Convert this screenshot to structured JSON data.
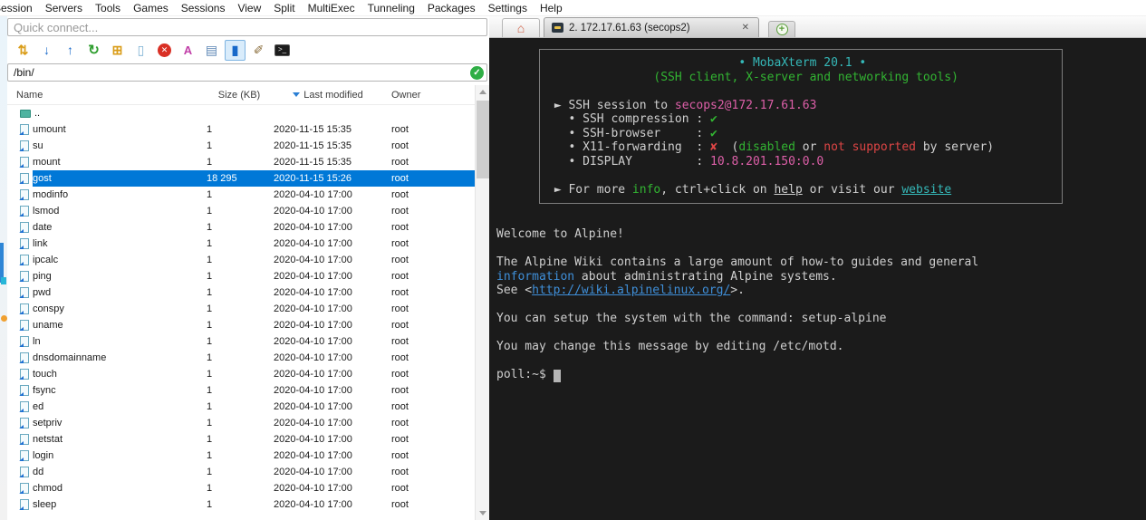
{
  "menu": {
    "items": [
      "Session",
      "Servers",
      "Tools",
      "Games",
      "Sessions",
      "View",
      "Split",
      "MultiExec",
      "Tunneling",
      "Packages",
      "Settings",
      "Help"
    ]
  },
  "sftp": {
    "quick_connect_placeholder": "Quick connect...",
    "path": "/bin/",
    "path_ok_glyph": "✓",
    "columns": {
      "name": "Name",
      "size": "Size (KB)",
      "modified": "Last modified",
      "owner": "Owner"
    },
    "toolbar": [
      {
        "name": "folder-transfer-icon",
        "glyph": "⇅",
        "cls": "tb-yellow"
      },
      {
        "name": "download-icon",
        "glyph": "↓",
        "cls": "tb-blue"
      },
      {
        "name": "upload-icon",
        "glyph": "↑",
        "cls": "tb-blue"
      },
      {
        "name": "refresh-icon",
        "glyph": "↻",
        "cls": "tb-green"
      },
      {
        "name": "new-folder-icon",
        "glyph": "⊞",
        "cls": "tb-yellow"
      },
      {
        "name": "new-file-icon",
        "glyph": "▯",
        "cls": "tb-page"
      },
      {
        "name": "delete-icon",
        "glyph": "✕",
        "cls": "tb-del"
      },
      {
        "name": "rename-icon",
        "glyph": "A",
        "cls": "tb-pink"
      },
      {
        "name": "edit-file-icon",
        "glyph": "▤",
        "cls": "tb-steel"
      },
      {
        "name": "follow-terminal-folder-icon",
        "glyph": "▮",
        "cls": "tb-blue",
        "active": true
      },
      {
        "name": "find-icon",
        "glyph": "✐",
        "cls": "tb-pen"
      },
      {
        "name": "console-icon",
        "glyph": ">_",
        "cls": "tb-console"
      }
    ],
    "rows": [
      {
        "name": "..",
        "size": "",
        "modified": "",
        "owner": "",
        "type": "up"
      },
      {
        "name": "umount",
        "size": "1",
        "modified": "2020-11-15 15:35",
        "owner": "root"
      },
      {
        "name": "su",
        "size": "1",
        "modified": "2020-11-15 15:35",
        "owner": "root"
      },
      {
        "name": "mount",
        "size": "1",
        "modified": "2020-11-15 15:35",
        "owner": "root"
      },
      {
        "name": "gost",
        "size": "18 295",
        "modified": "2020-11-15 15:26",
        "owner": "root",
        "selected": true
      },
      {
        "name": "modinfo",
        "size": "1",
        "modified": "2020-04-10 17:00",
        "owner": "root"
      },
      {
        "name": "lsmod",
        "size": "1",
        "modified": "2020-04-10 17:00",
        "owner": "root"
      },
      {
        "name": "date",
        "size": "1",
        "modified": "2020-04-10 17:00",
        "owner": "root"
      },
      {
        "name": "link",
        "size": "1",
        "modified": "2020-04-10 17:00",
        "owner": "root"
      },
      {
        "name": "ipcalc",
        "size": "1",
        "modified": "2020-04-10 17:00",
        "owner": "root"
      },
      {
        "name": "ping",
        "size": "1",
        "modified": "2020-04-10 17:00",
        "owner": "root"
      },
      {
        "name": "pwd",
        "size": "1",
        "modified": "2020-04-10 17:00",
        "owner": "root"
      },
      {
        "name": "conspy",
        "size": "1",
        "modified": "2020-04-10 17:00",
        "owner": "root"
      },
      {
        "name": "uname",
        "size": "1",
        "modified": "2020-04-10 17:00",
        "owner": "root"
      },
      {
        "name": "ln",
        "size": "1",
        "modified": "2020-04-10 17:00",
        "owner": "root"
      },
      {
        "name": "dnsdomainname",
        "size": "1",
        "modified": "2020-04-10 17:00",
        "owner": "root"
      },
      {
        "name": "touch",
        "size": "1",
        "modified": "2020-04-10 17:00",
        "owner": "root"
      },
      {
        "name": "fsync",
        "size": "1",
        "modified": "2020-04-10 17:00",
        "owner": "root"
      },
      {
        "name": "ed",
        "size": "1",
        "modified": "2020-04-10 17:00",
        "owner": "root"
      },
      {
        "name": "setpriv",
        "size": "1",
        "modified": "2020-04-10 17:00",
        "owner": "root"
      },
      {
        "name": "netstat",
        "size": "1",
        "modified": "2020-04-10 17:00",
        "owner": "root"
      },
      {
        "name": "login",
        "size": "1",
        "modified": "2020-04-10 17:00",
        "owner": "root"
      },
      {
        "name": "dd",
        "size": "1",
        "modified": "2020-04-10 17:00",
        "owner": "root"
      },
      {
        "name": "chmod",
        "size": "1",
        "modified": "2020-04-10 17:00",
        "owner": "root"
      },
      {
        "name": "sleep",
        "size": "1",
        "modified": "2020-04-10 17:00",
        "owner": "root"
      }
    ]
  },
  "tabs": {
    "home_glyph": "⌂",
    "session_tab": "2. 172.17.61.63 (secops2)",
    "close_label": "✕",
    "new_tab_label": "+"
  },
  "colors": {
    "selection_blue": "#0078d7",
    "terminal_bg": "#1b1b1b",
    "terminal_cyan": "#35b8b8",
    "terminal_green": "#32b432",
    "terminal_pink": "#dd5fa8",
    "terminal_red": "#de4545",
    "terminal_blue": "#3f8fd9"
  },
  "terminal": {
    "banner_lines": [
      [
        {
          "t": "                           "
        },
        {
          "t": "• MobaXterm 20.1 •",
          "c": "c"
        }
      ],
      [
        {
          "t": "               "
        },
        {
          "t": "(SSH client, X-server and networking tools)",
          "c": "g"
        }
      ],
      [],
      [
        {
          "t": " ► SSH session to "
        },
        {
          "t": "secops2@172.17.61.63",
          "c": "p"
        }
      ],
      [
        {
          "t": "   • SSH compression : "
        },
        {
          "t": "✔",
          "c": "g"
        }
      ],
      [
        {
          "t": "   • SSH-browser     : "
        },
        {
          "t": "✔",
          "c": "g"
        }
      ],
      [
        {
          "t": "   • X11-forwarding  : "
        },
        {
          "t": "✘",
          "c": "r"
        },
        {
          "t": "  ("
        },
        {
          "t": "disabled",
          "c": "g"
        },
        {
          "t": " or "
        },
        {
          "t": "not supported",
          "c": "r"
        },
        {
          "t": " by server)"
        }
      ],
      [
        {
          "t": "   • DISPLAY         : "
        },
        {
          "t": "10.8.201.150:0.0",
          "c": "p"
        }
      ],
      [],
      [
        {
          "t": " ► For more "
        },
        {
          "t": "info",
          "c": "g"
        },
        {
          "t": ", ctrl+click on "
        },
        {
          "t": "help",
          "c": "u"
        },
        {
          "t": " or visit our "
        },
        {
          "t": "website",
          "c": "cu"
        }
      ]
    ],
    "body_lines": [
      [
        {
          "t": "Welcome to Alpine!"
        }
      ],
      [],
      [
        {
          "t": "The Alpine Wiki contains a large amount of how-to guides and general"
        }
      ],
      [
        {
          "t": "information",
          "c": "b"
        },
        {
          "t": " about administrating Alpine systems."
        }
      ],
      [
        {
          "t": "See <"
        },
        {
          "t": "http://wiki.alpinelinux.org/",
          "c": "bu"
        },
        {
          "t": ">."
        }
      ],
      [],
      [
        {
          "t": "You can setup the system with the command: setup-alpine"
        }
      ],
      [],
      [
        {
          "t": "You may change this message by editing /etc/motd."
        }
      ],
      [],
      [
        {
          "t": "poll:~$ "
        },
        {
          "t": " ",
          "c": "cursor"
        }
      ]
    ]
  }
}
